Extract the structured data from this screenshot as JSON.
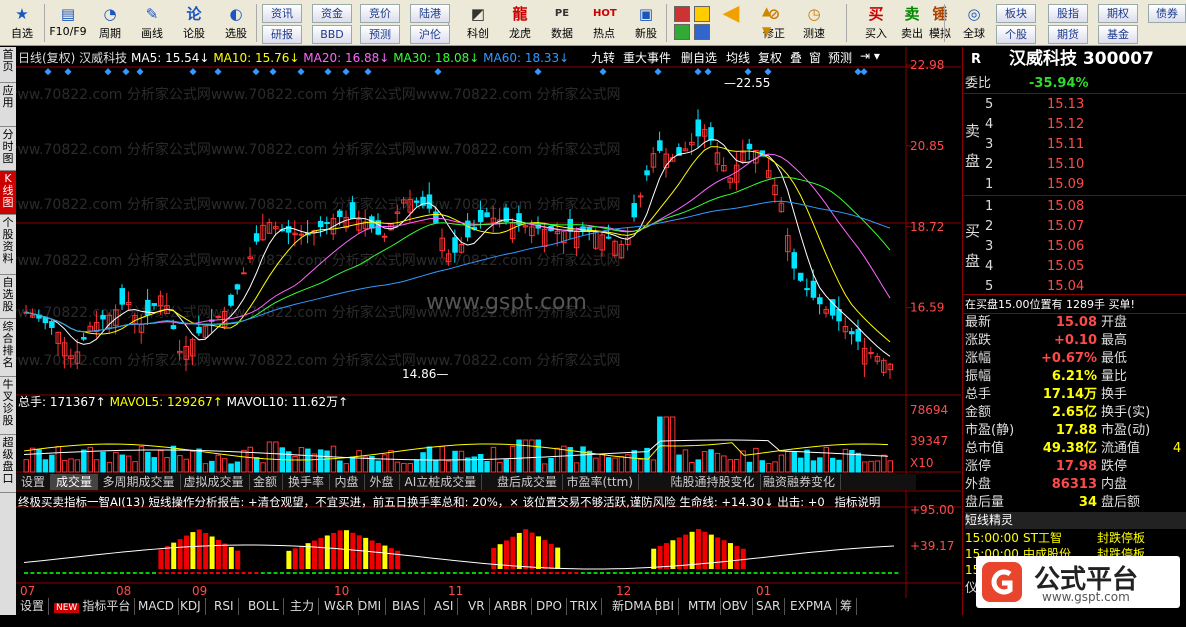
{
  "toolbar": {
    "buttons": [
      {
        "label": "自选",
        "icon": "★"
      },
      {
        "label": "F10/F9",
        "icon": "▤"
      },
      {
        "label": "周期",
        "icon": "◔"
      },
      {
        "label": "画线",
        "icon": "✎"
      },
      {
        "label": "论股",
        "icon": "论"
      },
      {
        "label": "选股",
        "icon": "◐"
      },
      {
        "label": "科创",
        "icon": "◩"
      },
      {
        "label": "龙虎",
        "icon": "龍"
      },
      {
        "label": "数据",
        "icon": "PE"
      },
      {
        "label": "热点",
        "icon": "HOT"
      },
      {
        "label": "新股",
        "icon": "▣"
      },
      {
        "label": "修正",
        "icon": "⊘"
      },
      {
        "label": "测速",
        "icon": "◷"
      },
      {
        "label": "买入",
        "icon": "买"
      },
      {
        "label": "卖出",
        "icon": "卖"
      },
      {
        "label": "模拟",
        "icon": "锤"
      },
      {
        "label": "全球",
        "icon": "◎"
      }
    ],
    "grid_buttons": [
      {
        "label": "资讯"
      },
      {
        "label": "资金"
      },
      {
        "label": "竞价"
      },
      {
        "label": "陆港"
      },
      {
        "label": "研报"
      },
      {
        "label": "BBD"
      },
      {
        "label": "预测"
      },
      {
        "label": "沪伦"
      },
      {
        "label": "板块"
      },
      {
        "label": "股指"
      },
      {
        "label": "期权"
      },
      {
        "label": "债券"
      },
      {
        "label": "个股"
      },
      {
        "label": "期货"
      },
      {
        "label": "基金"
      }
    ]
  },
  "left_tabs": [
    "首页",
    "应用",
    "分时图",
    "K线图",
    "个股资料",
    "自选股",
    "综合排名",
    "牛叉诊股",
    "超级盘口"
  ],
  "kline": {
    "header": "日线(复权) 汉威科技",
    "ma5": "MA5: 15.54↓",
    "ma10": "MA10: 15.76↓",
    "ma20": "MA20: 16.88↓",
    "ma30": "MA30: 18.08↓",
    "ma60": "MA60: 18.33↓",
    "top_tools": [
      "九转",
      "重大事件",
      "删自选",
      "均线",
      "复权",
      "叠",
      "窗",
      "预测"
    ],
    "price_axis": [
      "22.98",
      "20.85",
      "18.72",
      "16.59"
    ],
    "high_label": "22.55",
    "low_label": "14.86",
    "watermark_site": "www.gspt.com",
    "watermark_text": "www.70822.com 分析家公式网www.70822.com 分析家公式网www.70822.com 分析家公式网"
  },
  "volume": {
    "header": "总手: 171367↑",
    "mavol5": "MAVOL5: 129267↑",
    "mavol10": "MAVOL10: 11.62万↑",
    "axis": [
      "78694",
      "39347",
      "X10"
    ]
  },
  "tabs": [
    "设置",
    "成交量",
    "多周期成交量",
    "虚拟成交量",
    "金额",
    "换手率",
    "内盘",
    "外盘",
    "AI立桩成交量",
    "盘后成交量",
    "市盈率(ttm)",
    "陆股通持股变化",
    "融资融券变化"
  ],
  "indicator": {
    "text": "终极买卖指标一智AI(13) 短线操作分析报告: +清仓观望，不宜买进，前五日换手率总和: 20%，× 该位置交易不够活跃,谨防风险 生命线: +14.30↓ 出击: +0",
    "explain": "指标说明",
    "axis": [
      "+95.00",
      "+39.17"
    ]
  },
  "months": [
    "07",
    "08",
    "09",
    "10",
    "11",
    "12",
    "01"
  ],
  "bottom_tabs": [
    "设置",
    "指标平台",
    "MACD",
    "KDJ",
    "RSI",
    "BOLL",
    "主力",
    "W&R",
    "DMI",
    "BIAS",
    "ASI",
    "VR",
    "ARBR",
    "DPO",
    "TRIX",
    "新DMA",
    "BBI",
    "MTM",
    "OBV",
    "SAR",
    "EXPMA",
    "筹"
  ],
  "new_badge": "NEW",
  "right": {
    "code_r": "R",
    "title": "汉威科技 300007",
    "weibi_label": "委比",
    "weibi": "-35.94%",
    "sell": [
      {
        "n": "5",
        "p": "15.13"
      },
      {
        "n": "4",
        "p": "15.12"
      },
      {
        "n": "3",
        "p": "15.11"
      },
      {
        "n": "2",
        "p": "15.10"
      },
      {
        "n": "1",
        "p": "15.09"
      }
    ],
    "buy": [
      {
        "n": "1",
        "p": "15.08"
      },
      {
        "n": "2",
        "p": "15.07"
      },
      {
        "n": "3",
        "p": "15.06"
      },
      {
        "n": "4",
        "p": "15.05"
      },
      {
        "n": "5",
        "p": "15.04"
      }
    ],
    "sell_side": "卖盘",
    "buy_side": "买盘",
    "notice": "在买盘15.00位置有  1289手  买单!",
    "stats": [
      [
        "最新",
        "15.08",
        "开盘",
        ""
      ],
      [
        "涨跌",
        "+0.10",
        "最高",
        ""
      ],
      [
        "涨幅",
        "+0.67%",
        "最低",
        ""
      ],
      [
        "振幅",
        "6.21%",
        "量比",
        ""
      ],
      [
        "总手",
        "17.14万",
        "换手",
        ""
      ],
      [
        "金额",
        "2.65亿",
        "换手(实)",
        ""
      ],
      [
        "市盈(静)",
        "17.88",
        "市盈(动)",
        ""
      ],
      [
        "总市值",
        "49.38亿",
        "流通值",
        "4"
      ],
      [
        "涨停",
        "17.98",
        "跌停",
        ""
      ],
      [
        "外盘",
        "86313",
        "内盘",
        ""
      ],
      [
        "盘后量",
        "34",
        "盘后额",
        ""
      ]
    ],
    "jingling": "短线精灵",
    "feed": [
      [
        "15:00:00",
        "ST工智",
        "封跌停板"
      ],
      [
        "15:00:00",
        "中成股份",
        "封跌停板"
      ],
      [
        "15",
        "",
        " "
      ]
    ],
    "tail_chars": [
      "仪",
      "15"
    ]
  },
  "logo_text": "公式平台",
  "logo_url": "www.gspt.com",
  "colors": {
    "up": "#ff3333",
    "down": "#00e5ff",
    "ma5": "#ffffff",
    "ma10": "#ffff00",
    "ma20": "#ff66ff",
    "ma30": "#33ff33",
    "ma60": "#3399ff"
  }
}
